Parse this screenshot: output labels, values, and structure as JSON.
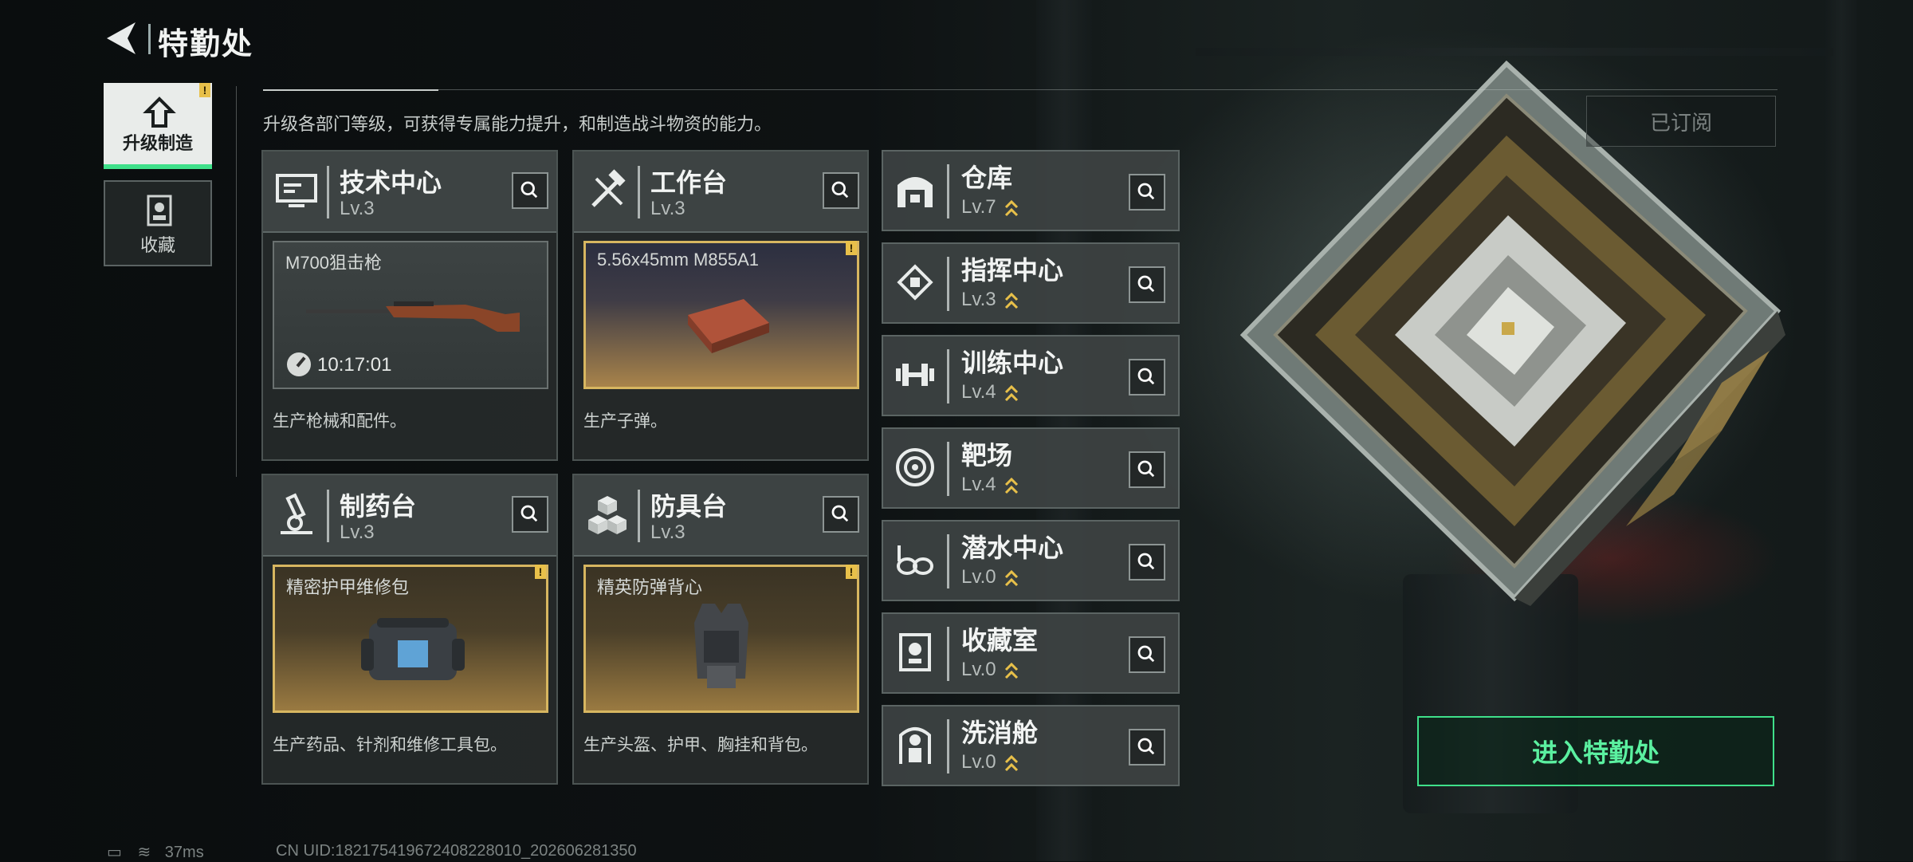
{
  "header": {
    "title": "特勤处"
  },
  "side_tabs": [
    {
      "label": "升级制造",
      "icon": "upgrade-craft-icon",
      "active": true
    },
    {
      "label": "收藏",
      "icon": "collection-icon",
      "active": false
    }
  ],
  "description": "升级各部门等级，可获得专属能力提升，和制造战斗物资的能力。",
  "subscribed_label": "已订阅",
  "cards": [
    {
      "name": "技术中心",
      "level": "Lv.3",
      "icon": "monitor-icon",
      "item": "M700狙击枪",
      "timer": "10:17:01",
      "desc": "生产枪械和配件。"
    },
    {
      "name": "工作台",
      "level": "Lv.3",
      "icon": "tools-icon",
      "item": "5.56x45mm M855A1",
      "desc": "生产子弹。"
    },
    {
      "name": "制药台",
      "level": "Lv.3",
      "icon": "microscope-icon",
      "item": "精密护甲维修包",
      "desc": "生产药品、针剂和维修工具包。"
    },
    {
      "name": "防具台",
      "level": "Lv.3",
      "icon": "cubes-icon",
      "item": "精英防弹背心",
      "desc": "生产头盔、护甲、胸挂和背包。"
    }
  ],
  "facilities": [
    {
      "name": "仓库",
      "level": "Lv.7",
      "icon": "warehouse-icon"
    },
    {
      "name": "指挥中心",
      "level": "Lv.3",
      "icon": "command-chip-icon"
    },
    {
      "name": "训练中心",
      "level": "Lv.4",
      "icon": "dumbbell-icon"
    },
    {
      "name": "靶场",
      "level": "Lv.4",
      "icon": "target-icon"
    },
    {
      "name": "潜水中心",
      "level": "Lv.0",
      "icon": "diving-goggles-icon"
    },
    {
      "name": "收藏室",
      "level": "Lv.0",
      "icon": "trophy-case-icon"
    },
    {
      "name": "洗消舱",
      "level": "Lv.0",
      "icon": "decon-suit-icon"
    }
  ],
  "enter_button": "进入特勤处",
  "status": {
    "ping": "37ms",
    "uid": "CN UID:18217541967240822801​0_202606281350"
  },
  "colors": {
    "accent_green": "#3fe08a",
    "gold": "#d7b660",
    "upgrade_arrow": "#e8c04a"
  }
}
